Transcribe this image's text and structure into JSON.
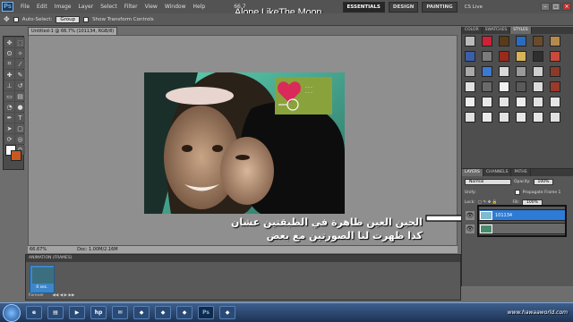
{
  "overlay_title": "Alone LikeThe Moon",
  "menubar": {
    "logo": "Ps",
    "menus": [
      "File",
      "Edit",
      "Image",
      "Layer",
      "Select",
      "Filter",
      "View",
      "Window",
      "Help"
    ],
    "zoom": "66.7",
    "workspaces": [
      "ESSENTIALS",
      "DESIGN",
      "PAINTING"
    ],
    "cs_live": "CS Live"
  },
  "options_bar": {
    "auto_select_label": "Auto-Select:",
    "auto_select_value": "Group",
    "transform_label": "Show Transform Controls"
  },
  "document": {
    "tab_title": "Untitled-1 @ 66.7% (101134, RGB/8)",
    "status_zoom": "66.67%",
    "status_doc": "Doc: 1.00M/2.16M"
  },
  "annotation": {
    "line1": "الحين العين ظاهرة في الطبقتين عشان",
    "line2": "كذا ظهرت لنا الصورتين مع بعض"
  },
  "right_panel": {
    "top_tabs": [
      "COLOR",
      "SWATCHES",
      "STYLES"
    ],
    "layer_tabs": [
      "LAYERS",
      "CHANNELS",
      "PATHS"
    ],
    "blend_mode": "Normal",
    "opacity_label": "Opacity:",
    "opacity": "100%",
    "unify_label": "Unify:",
    "propagate_label": "Propagate Frame 1",
    "lock_label": "Lock:",
    "fill_label": "Fill:",
    "fill": "100%",
    "layers": [
      {
        "name": "101134",
        "selected": true
      },
      {
        "name": "",
        "selected": false
      }
    ]
  },
  "animation": {
    "title": "ANIMATION (FRAMES)",
    "frame_number": "1",
    "frame_time": "0 sec.",
    "loop": "Forever"
  },
  "taskbar": {
    "ps_label": "Ps",
    "watermark": "www.hawaaworld.com"
  },
  "colors": {
    "selected_layer": "#2d7bd5",
    "background_swatch": "#c9581e"
  }
}
